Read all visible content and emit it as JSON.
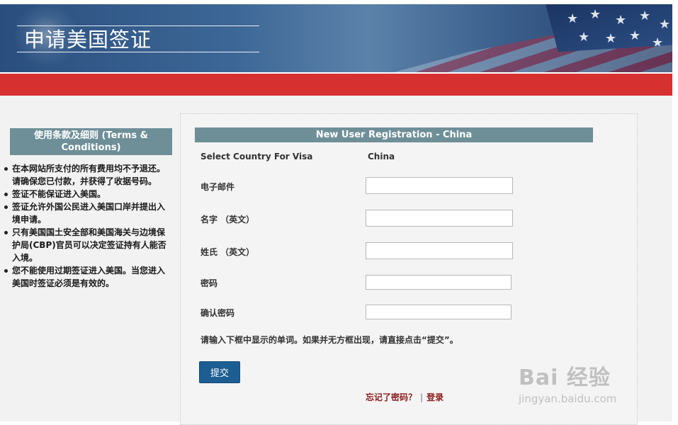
{
  "header": {
    "title": "申请美国签证"
  },
  "sidebar": {
    "heading": "使用条款及细则 (Terms & Conditions)",
    "items": [
      "在本网站所支付的所有费用均不予退还。请确保您已付款，并获得了收据号码。",
      "签证不能保证进入美国。",
      "签证允许外国公民进入美国口岸并提出入境申请。",
      "只有美国国土安全部和美国海关与边境保护局(CBP)官员可以决定签证持有人能否入境。",
      "您不能使用过期签证进入美国。当您进入美国时签证必须是有效的。"
    ]
  },
  "form": {
    "heading": "New User Registration - China",
    "country_label": "Select Country For Visa",
    "country_value": "China",
    "email_label": "电子邮件",
    "email_value": "",
    "given_name_label": "名字 （英文）",
    "given_name_value": "",
    "surname_label": "姓氏 （英文）",
    "surname_value": "",
    "password_label": "密码",
    "password_value": "",
    "confirm_password_label": "确认密码",
    "confirm_password_value": "",
    "captcha_hint": "请输入下框中显示的单词。如果并无方框出现，请直接点击“提交”。",
    "submit_label": "提交"
  },
  "links": {
    "forgot_password": "忘记了密码？",
    "separator": "|",
    "login": "登录"
  },
  "watermark": {
    "main": "Bai 经验",
    "sub": "jingyan.baidu.com"
  },
  "colors": {
    "banner_blue": "#3d6796",
    "red_bar": "#d63031",
    "section_header": "#6e8f98",
    "button": "#1d5e92",
    "link": "#8b1a1a"
  }
}
